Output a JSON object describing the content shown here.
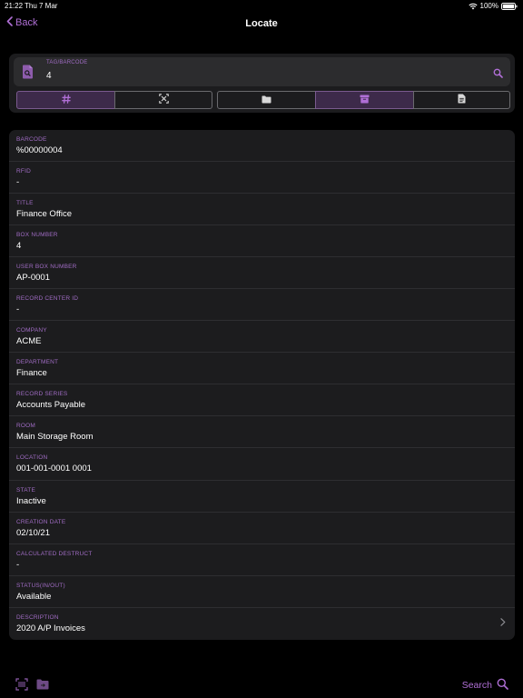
{
  "status_bar": {
    "time": "21:22",
    "date": "Thu 7 Mar",
    "battery": "100%"
  },
  "nav": {
    "back_label": "Back",
    "title": "Locate"
  },
  "search": {
    "field_label": "TAG/BARCODE",
    "field_value": "4",
    "icons": [
      "document-search-icon",
      "search-icon"
    ]
  },
  "segments": {
    "group1": [
      {
        "icon": "hash-icon",
        "active": true
      },
      {
        "icon": "scan-rfid-icon",
        "active": false
      }
    ],
    "group2": [
      {
        "icon": "folder-icon",
        "active": false
      },
      {
        "icon": "box-icon",
        "active": true
      },
      {
        "icon": "document-icon",
        "active": false
      }
    ]
  },
  "details": [
    {
      "label": "BARCODE",
      "value": "%00000004"
    },
    {
      "label": "RFID",
      "value": "-"
    },
    {
      "label": "TITLE",
      "value": "Finance Office"
    },
    {
      "label": "BOX NUMBER",
      "value": "4"
    },
    {
      "label": "USER BOX NUMBER",
      "value": "AP-0001"
    },
    {
      "label": "RECORD CENTER ID",
      "value": "-"
    },
    {
      "label": "COMPANY",
      "value": "ACME"
    },
    {
      "label": "DEPARTMENT",
      "value": "Finance"
    },
    {
      "label": "RECORD SERIES",
      "value": "Accounts Payable"
    },
    {
      "label": "ROOM",
      "value": "Main Storage Room"
    },
    {
      "label": "LOCATION",
      "value": "001-001-0001 0001"
    },
    {
      "label": "STATE",
      "value": "Inactive"
    },
    {
      "label": "CREATION DATE",
      "value": "02/10/21"
    },
    {
      "label": "CALCULATED DESTRUCT",
      "value": "-"
    },
    {
      "label": "STATUS(IN/OUT)",
      "value": "Available"
    },
    {
      "label": "DESCRIPTION",
      "value": "2020 A/P Invoices"
    }
  ],
  "bottom_bar": {
    "search_label": "Search"
  },
  "colors": {
    "accent": "#b06fd6",
    "label": "#a06cc4",
    "card": "#1c1c1e",
    "background": "#000000"
  }
}
